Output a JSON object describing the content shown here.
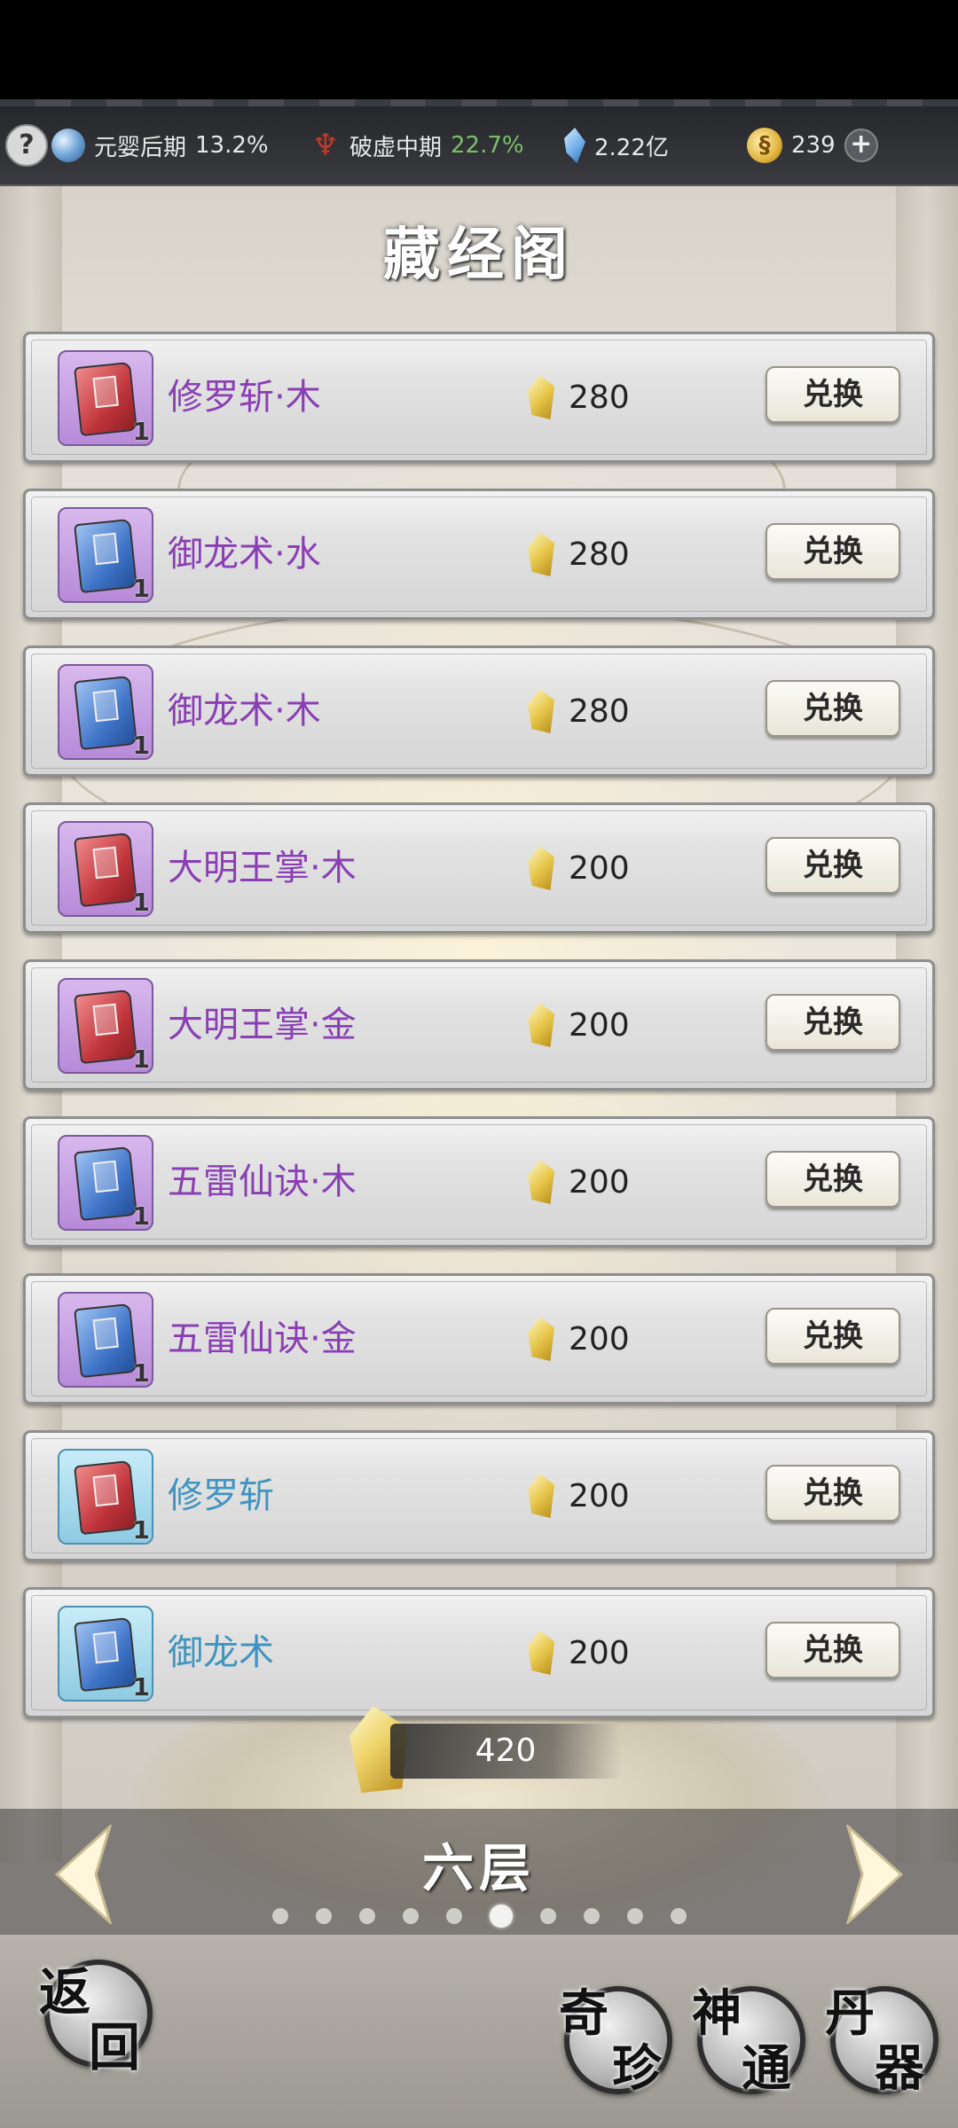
{
  "topbar": {
    "help_icon": "?",
    "realm_label": "元婴后期",
    "realm_pct": "13.2%",
    "stage_label": "破虚中期",
    "stage_pct": "22.7%",
    "spirit_stones": "2.22亿",
    "gold": "239",
    "accent_green": "#7bbf6a"
  },
  "page": {
    "title": "藏经阁"
  },
  "items": [
    {
      "name": "修罗斩·木",
      "price": "280",
      "qty": "1",
      "book_color": "red",
      "frame": "purple",
      "button": "兑换"
    },
    {
      "name": "御龙术·水",
      "price": "280",
      "qty": "1",
      "book_color": "blue",
      "frame": "purple",
      "button": "兑换"
    },
    {
      "name": "御龙术·木",
      "price": "280",
      "qty": "1",
      "book_color": "blue",
      "frame": "purple",
      "button": "兑换"
    },
    {
      "name": "大明王掌·木",
      "price": "200",
      "qty": "1",
      "book_color": "red",
      "frame": "purple",
      "button": "兑换"
    },
    {
      "name": "大明王掌·金",
      "price": "200",
      "qty": "1",
      "book_color": "red",
      "frame": "purple",
      "button": "兑换"
    },
    {
      "name": "五雷仙诀·木",
      "price": "200",
      "qty": "1",
      "book_color": "blue",
      "frame": "purple",
      "button": "兑换"
    },
    {
      "name": "五雷仙诀·金",
      "price": "200",
      "qty": "1",
      "book_color": "blue",
      "frame": "purple",
      "button": "兑换"
    },
    {
      "name": "修罗斩",
      "price": "200",
      "qty": "1",
      "book_color": "red",
      "frame": "cyan",
      "button": "兑换"
    },
    {
      "name": "御龙术",
      "price": "200",
      "qty": "1",
      "book_color": "blue",
      "frame": "cyan",
      "button": "兑换"
    }
  ],
  "currency": {
    "amount": "420"
  },
  "floor_nav": {
    "label": "六层",
    "page_count": 10,
    "active_index": 5
  },
  "bottom": {
    "back_top": "返",
    "back_bottom": "回",
    "treasure_top": "奇",
    "treasure_bottom": "珍",
    "skills_top": "神",
    "skills_bottom": "通",
    "artifacts_top": "丹",
    "artifacts_bottom": "器"
  }
}
